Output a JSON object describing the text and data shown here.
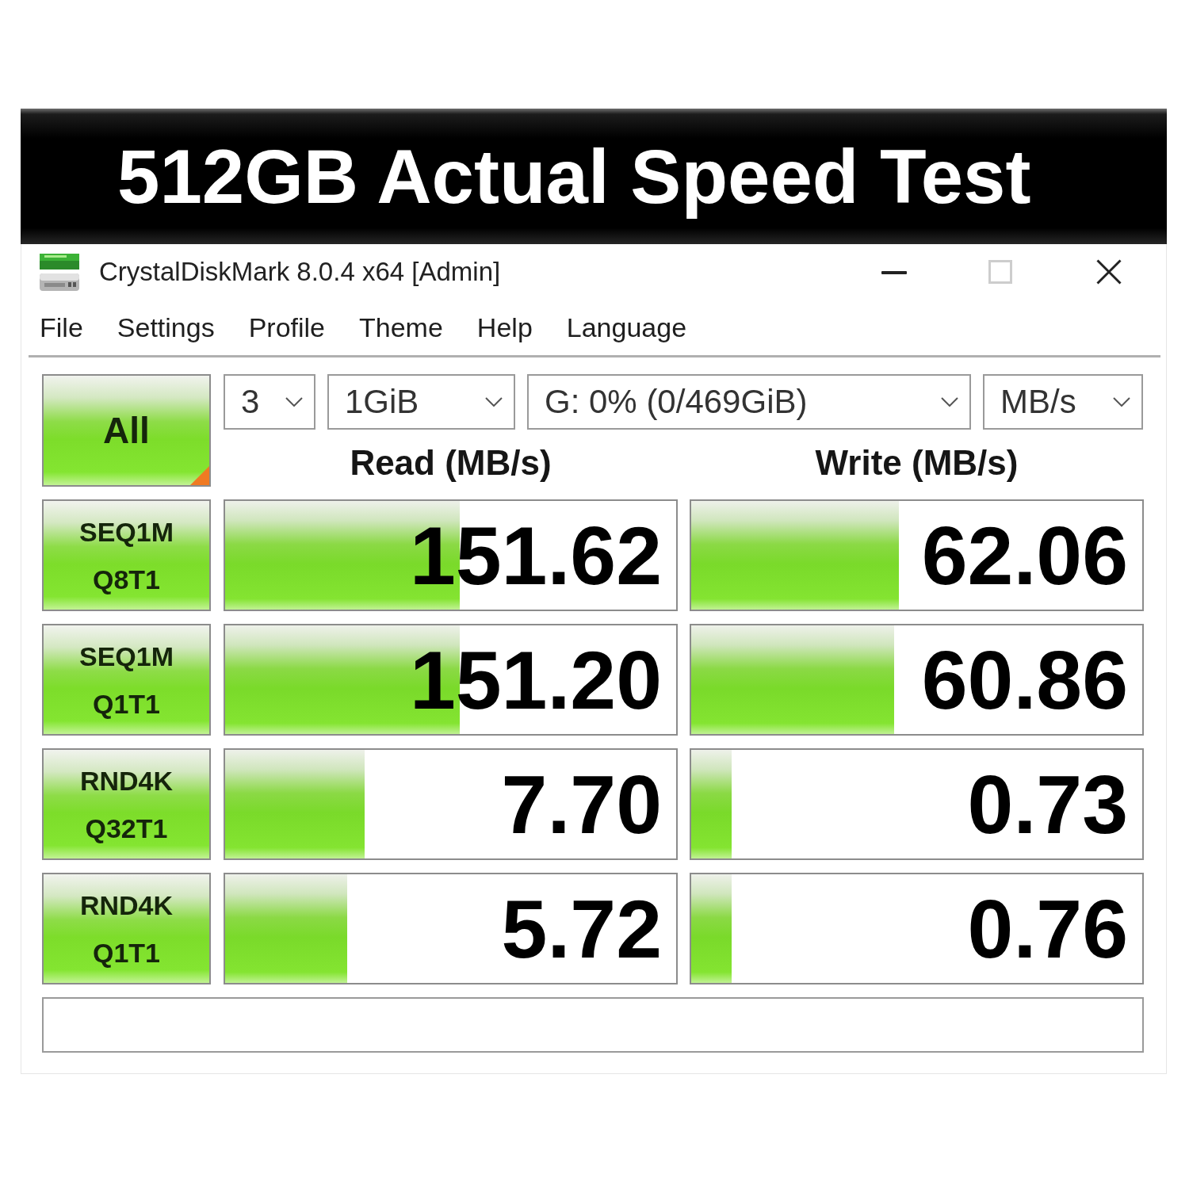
{
  "banner": {
    "title": "512GB Actual Speed Test"
  },
  "window": {
    "title": "CrystalDiskMark 8.0.4 x64 [Admin]"
  },
  "window_controls": [
    {
      "kind": "minimize",
      "disabled": false
    },
    {
      "kind": "maximize",
      "disabled": true
    },
    {
      "kind": "close",
      "disabled": false
    }
  ],
  "menu": [
    "File",
    "Settings",
    "Profile",
    "Theme",
    "Help",
    "Language"
  ],
  "all_button": {
    "label": "All"
  },
  "settings": [
    "3",
    "1GiB",
    "G: 0% (0/469GiB)",
    "MB/s"
  ],
  "columns": [
    "Read (MB/s)",
    "Write (MB/s)"
  ],
  "tests": [
    {
      "label": [
        "SEQ1M",
        "Q8T1"
      ],
      "read": {
        "value": "151.62",
        "level": 0.52
      },
      "write": {
        "value": "62.06",
        "level": 0.46
      }
    },
    {
      "label": [
        "SEQ1M",
        "Q1T1"
      ],
      "read": {
        "value": "151.20",
        "level": 0.52
      },
      "write": {
        "value": "60.86",
        "level": 0.45
      }
    },
    {
      "label": [
        "RND4K",
        "Q32T1"
      ],
      "read": {
        "value": "7.70",
        "level": 0.31
      },
      "write": {
        "value": "0.73",
        "level": 0.09
      }
    },
    {
      "label": [
        "RND4K",
        "Q1T1"
      ],
      "read": {
        "value": "5.72",
        "level": 0.27
      },
      "write": {
        "value": "0.76",
        "level": 0.09
      }
    }
  ]
}
